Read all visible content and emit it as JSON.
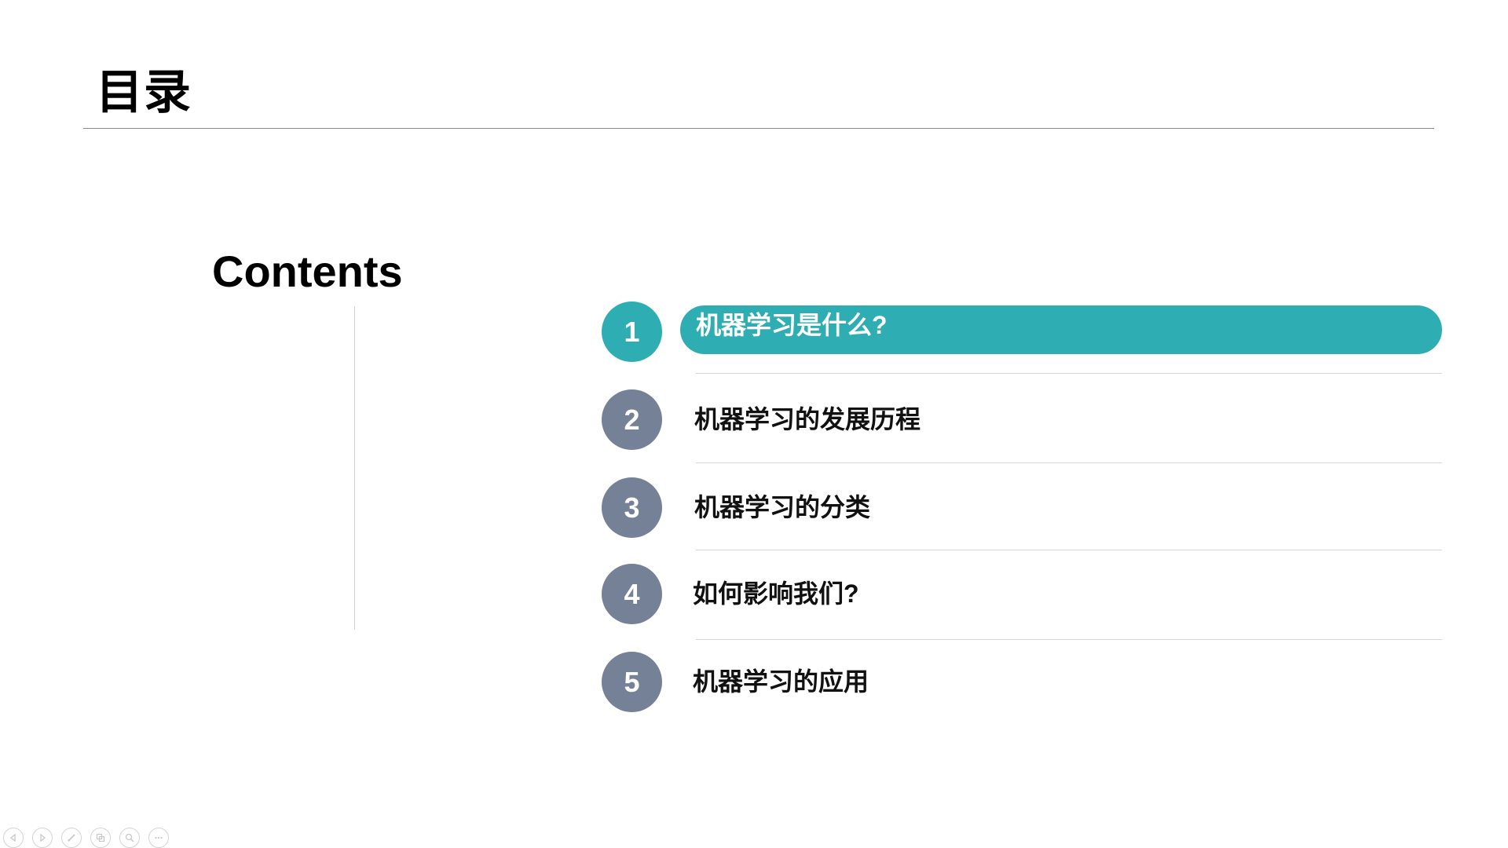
{
  "slide": {
    "title": "目录",
    "contents_heading": "Contents",
    "accent_color": "#2eaeb2",
    "inactive_circle_color": "#758196",
    "items": [
      {
        "number": "1",
        "label": "机器学习是什么?",
        "active": true
      },
      {
        "number": "2",
        "label": "机器学习的发展历程",
        "active": false
      },
      {
        "number": "3",
        "label": "机器学习的分类",
        "active": false
      },
      {
        "number": "4",
        "label": "如何影响我们?",
        "active": false
      },
      {
        "number": "5",
        "label": "机器学习的应用",
        "active": false
      }
    ]
  },
  "toolbar": {
    "buttons": [
      {
        "name": "previous-slide",
        "icon": "arrow-left-icon"
      },
      {
        "name": "next-slide",
        "icon": "arrow-right-icon"
      },
      {
        "name": "pen",
        "icon": "pen-icon"
      },
      {
        "name": "see-all-slides",
        "icon": "slides-icon"
      },
      {
        "name": "zoom",
        "icon": "magnifier-icon"
      },
      {
        "name": "more-options",
        "icon": "more-icon"
      }
    ]
  }
}
